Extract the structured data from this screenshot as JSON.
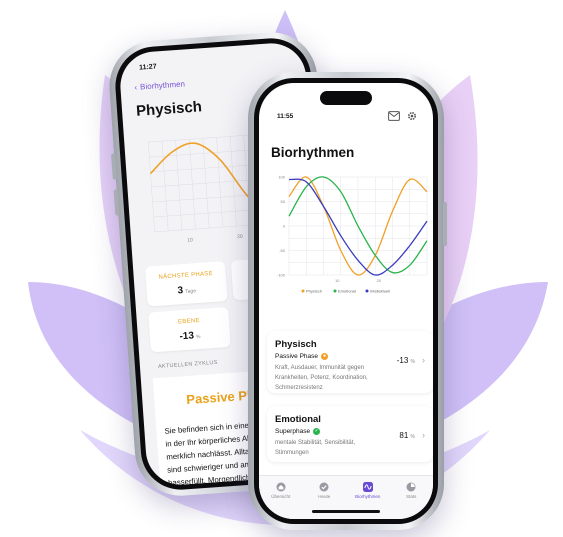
{
  "colors": {
    "physisch": "#f0a028",
    "emotional": "#28b44a",
    "intellektuell": "#3a3dbf",
    "accent": "#7a56d8",
    "petal_light": "#e2d5fa",
    "petal_dark": "#b99cf0"
  },
  "detail_screen": {
    "time": "11:27",
    "back_label": "Biorhythmen",
    "title": "Physisch",
    "chart_tick_labels": [
      "10",
      "20"
    ],
    "tiles": [
      {
        "label": "NÄCHSTE PHASE",
        "value": "3",
        "unit": "Tage"
      },
      {
        "label": "EBENE",
        "value": "-13",
        "unit": "%"
      }
    ],
    "section_label": "AKTUELLEN ZYKLUS",
    "phase_title": "Passive Phase",
    "description_lines": [
      "Sie befinden sich in einer passi",
      "in der Ihr körperliches Aktivitäts",
      "merklich nachlässt. Alltagsaktiv",
      "sind schwieriger und am Ende",
      "hasserfüllt."
    ],
    "description_link": "Morgendliches Erw"
  },
  "main_screen": {
    "time": "11:55",
    "header_icons": [
      "mail-icon",
      "gear-icon"
    ],
    "title": "Biorhythmen",
    "chart_y_ticks": [
      "100",
      "50",
      "0",
      "-50",
      "-100"
    ],
    "chart_x_ticks": [
      "10",
      "20"
    ],
    "legend": [
      "Physisch",
      "Emotional",
      "Intellektuell"
    ],
    "cards": [
      {
        "title": "Physisch",
        "phase": "Passive Phase",
        "phase_color": "#f0a028",
        "description": "Kraft, Ausdauer, Immunität gegen Krankheiten, Potenz, Koordination, Schmerzresistenz",
        "value": "-13",
        "unit": "%"
      },
      {
        "title": "Emotional",
        "phase": "Superphase",
        "phase_color": "#28b44a",
        "description": "mentale Stabilität, Sensibilität, Stimmungen",
        "value": "81",
        "unit": "%"
      }
    ],
    "tabs": [
      {
        "label": "Übersicht",
        "icon": "house-icon",
        "active": false
      },
      {
        "label": "Heute",
        "icon": "check-circle-icon",
        "active": false
      },
      {
        "label": "Biorhythmen",
        "icon": "wave-icon",
        "active": true
      },
      {
        "label": "Stats",
        "icon": "pie-chart-icon",
        "active": false
      }
    ]
  },
  "chart_data": [
    {
      "type": "line",
      "x": [
        0,
        4,
        8,
        12,
        16,
        20,
        24,
        28
      ],
      "series": [
        {
          "name": "Physisch",
          "values": [
            30,
            75,
            90,
            50,
            -30,
            -90,
            -70,
            10
          ]
        }
      ],
      "xlim": [
        0,
        28
      ],
      "ylim": [
        -100,
        100
      ],
      "grid": true
    },
    {
      "type": "line",
      "x": [
        0,
        4,
        8,
        12,
        16,
        20,
        24,
        28,
        32
      ],
      "series": [
        {
          "name": "Physisch",
          "values": [
            60,
            100,
            40,
            -50,
            -100,
            -60,
            30,
            95,
            70
          ]
        },
        {
          "name": "Emotional",
          "values": [
            20,
            80,
            100,
            70,
            0,
            -60,
            -95,
            -80,
            -30
          ]
        },
        {
          "name": "Intellektuell",
          "values": [
            95,
            90,
            40,
            -20,
            -70,
            -100,
            -80,
            -40,
            10
          ]
        }
      ],
      "xlim": [
        0,
        32
      ],
      "ylim": [
        -100,
        100
      ],
      "legend": "bottom",
      "grid": true
    }
  ]
}
